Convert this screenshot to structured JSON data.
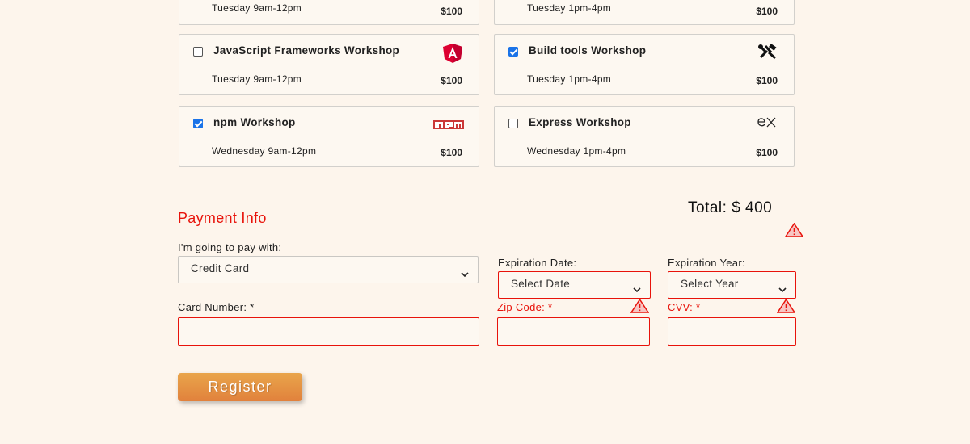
{
  "workshops": [
    {
      "name": "",
      "time": "Tuesday 9am-12pm",
      "price": "$100",
      "checked": false,
      "icon": "none"
    },
    {
      "name": "",
      "time": "Tuesday 1pm-4pm",
      "price": "$100",
      "checked": false,
      "icon": "none"
    },
    {
      "name": "JavaScript Frameworks Workshop",
      "time": "Tuesday 9am-12pm",
      "price": "$100",
      "checked": false,
      "icon": "angular-icon"
    },
    {
      "name": "Build tools Workshop",
      "time": "Tuesday 1pm-4pm",
      "price": "$100",
      "checked": true,
      "icon": "tools-icon"
    },
    {
      "name": "npm Workshop",
      "time": "Wednesday 9am-12pm",
      "price": "$100",
      "checked": true,
      "icon": "npm-icon"
    },
    {
      "name": "Express Workshop",
      "time": "Wednesday 1pm-4pm",
      "price": "$100",
      "checked": false,
      "icon": "express-icon"
    }
  ],
  "total_label": "Total: $ 400",
  "payment": {
    "title": "Payment Info",
    "pay_with_label": "I'm going to pay with:",
    "pay_with_value": "Credit Card",
    "exp_date_label": "Expiration Date:",
    "exp_date_value": "Select Date",
    "exp_year_label": "Expiration Year:",
    "exp_year_value": "Select Year",
    "card_number_label": "Card Number: *",
    "zip_label": "Zip Code: *",
    "cvv_label": "CVV: *"
  },
  "register_label": "Register",
  "colors": {
    "accent": "#e8130b",
    "background": "#fdf5ec",
    "checkbox": "#1a73e8",
    "button": "#e1813c"
  }
}
